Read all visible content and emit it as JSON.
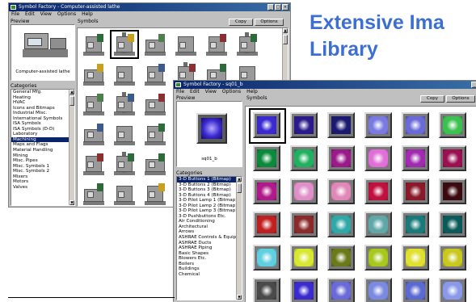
{
  "headline": {
    "line1": "Extensive Ima",
    "line2": "Library"
  },
  "window_back": {
    "title": "Symbol Factory - Computer-assisted lathe",
    "menus": [
      "File",
      "Edit",
      "View",
      "Options",
      "Help"
    ],
    "preview_label": "Preview",
    "symbols_label": "Symbols",
    "copy_button": "Copy",
    "options_button": "Options",
    "preview_caption": "Computer-assisted lathe",
    "categories_label": "Categories",
    "categories": [
      "General Mfg.",
      "Heating",
      "HVAC",
      "Icons and Bitmaps",
      "Industrial Misc.",
      "International Symbols",
      "ISA Symbols",
      "ISA Symbols (D-D)",
      "Laboratory",
      "Machining",
      "Maps and Flags",
      "Material Handling",
      "Mining",
      "Misc. Pipes",
      "Misc. Symbols 1",
      "Misc. Symbols 2",
      "Mixers",
      "Motors",
      "Valves"
    ],
    "selected_category": "Machining",
    "window_buttons": [
      "_",
      "□",
      "×"
    ],
    "machine_accents": [
      "#2f6b3a",
      "#c8a020",
      "#4f7f4f",
      "#3c5a8a",
      "#8a3030",
      "#2f6b3a"
    ]
  },
  "window_front": {
    "title": "Symbol Factory - sq01_b",
    "menus": [
      "File",
      "Edit",
      "View",
      "Options",
      "Help"
    ],
    "preview_label": "Preview",
    "symbols_label": "Symbols",
    "copy_button": "Copy",
    "options_button": "Options",
    "preview_caption": "sq01_b",
    "categories_label": "Categories",
    "categories": [
      "3-D Buttons 1 (Bitmap)",
      "3-D Buttons 2 (Bitmap)",
      "3-D Buttons 3 (Bitmap)",
      "3-D Buttons 4 (Bitmap)",
      "3-D Pilot Lamp 1 (Bitmap)",
      "3-D Pilot Lamp 2 (Bitmap)",
      "3-D Pilot Lamp 3 (Bitmap)",
      "3-D Pushbuttons Etc.",
      "Air Conditioning",
      "Architectural",
      "Arrows",
      "ASHRAE Controls & Equip.",
      "ASHRAE Ducts",
      "ASHRAE Piping",
      "Basic Shapes",
      "Blowers Etc.",
      "Boilers",
      "Buildings",
      "Chemical"
    ],
    "selected_category": "3-D Buttons 1 (Bitmap)",
    "button_colors": [
      [
        "#3a2ad0",
        "#2a1a8a",
        "#1a1a70",
        "#7a7ae0",
        "#6a6ad8",
        "#3cc050"
      ],
      [
        "#0a8a3a",
        "#20b060",
        "#9a1a8a",
        "#e070d8",
        "#a02ab0",
        "#9a1050"
      ],
      [
        "#b01a8a",
        "#e090c8",
        "#e088b8",
        "#c01040",
        "#8a1a2a",
        "#3a0a10"
      ],
      [
        "#c02020",
        "#8a2a2a",
        "#30a8a8",
        "#60a8a8",
        "#1a7a7a",
        "#0a5a5a"
      ],
      [
        "#60d0e0",
        "#d8e830",
        "#6a7a1a",
        "#a8c820",
        "#e0e030",
        "#c8c820"
      ],
      [
        "#4a4a4a",
        "#3a2ad0",
        "#6a6ad8",
        "#7a8ae0",
        "#5a6ad0",
        "#8a9ae8"
      ]
    ]
  }
}
